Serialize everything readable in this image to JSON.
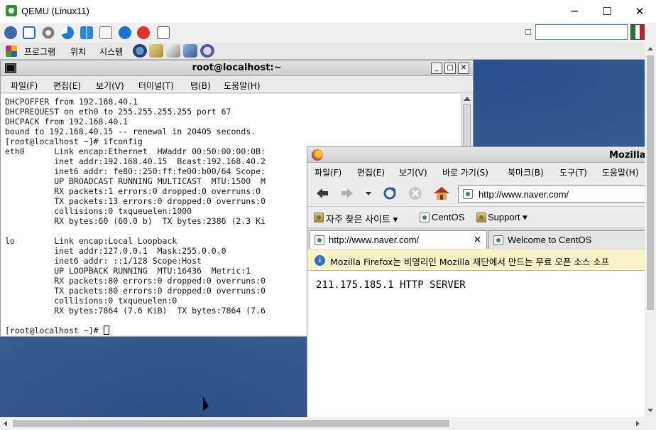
{
  "host": {
    "title": "QEMU (Linux11)",
    "controls": {
      "minimize": "─",
      "maximize": "☐",
      "close": "✕"
    }
  },
  "guest_panel": {
    "menus": [
      "프로그램",
      "위치",
      "시스템"
    ]
  },
  "terminal": {
    "title": "root@localhost:~",
    "window_buttons": {
      "minimize": "_",
      "maximize": "□",
      "close": "✕"
    },
    "menus": [
      "파일(F)",
      "편집(E)",
      "보기(V)",
      "터미널(T)",
      "탭(B)",
      "도움말(H)"
    ],
    "lines": [
      "DHCPOFFER from 192.168.40.1",
      "DHCPREQUEST on eth0 to 255.255.255.255 port 67",
      "DHCPACK from 192.168.40.1",
      "bound to 192.168.40.15 -- renewal in 20405 seconds.",
      "[root@localhost ~]# ifconfig",
      "eth0      Link encap:Ethernet  HWaddr 00:50:00:00:0B:",
      "          inet addr:192.168.40.15  Bcast:192.168.40.2",
      "          inet6 addr: fe80::250:ff:fe00:b00/64 Scope:",
      "          UP BROADCAST RUNNING MULTICAST  MTU:1500  M",
      "          RX packets:1 errors:0 dropped:0 overruns:0",
      "          TX packets:13 errors:0 dropped:0 overruns:0",
      "          collisions:0 txqueuelen:1000",
      "          RX bytes:60 (60.0 b)  TX bytes:2386 (2.3 Ki",
      "",
      "lo        Link encap:Local Loopback",
      "          inet addr:127.0.0.1  Mask:255.0.0.0",
      "          inet6 addr: ::1/128 Scope:Host",
      "          UP LOOPBACK RUNNING  MTU:16436  Metric:1",
      "          RX packets:80 errors:0 dropped:0 overruns:0",
      "          TX packets:80 errors:0 dropped:0 overruns:0",
      "          collisions:0 txqueuelen:0",
      "          RX bytes:7864 (7.6 KiB)  TX bytes:7864 (7.6",
      "",
      "[root@localhost ~]# "
    ]
  },
  "firefox": {
    "title": "Mozilla",
    "menus": [
      "파일(F)",
      "편집(E)",
      "보기(V)",
      "바로 가기(S)",
      "북마크(B)",
      "도구(T)",
      "도움말(H)"
    ],
    "url": "http://www.naver.com/",
    "bookmarks": {
      "frequent": "자주 찾은 사이트",
      "centos": "CentOS",
      "support": "Support"
    },
    "tabs": [
      {
        "label": "http://www.naver.com/",
        "close": "×"
      },
      {
        "label": "Welcome to CentOS"
      }
    ],
    "infobar": {
      "icon": "i",
      "text": "Mozilla Firefox는 비영리인 Mozilla 재단에서 만드는 무료 오픈 소스 소프"
    },
    "page_text": "211.175.185.1 HTTP SERVER"
  },
  "colors": {
    "desktop": "#3c5e92",
    "infobar": "#fbf3c6",
    "qemu_accent": "#4a90d9"
  }
}
